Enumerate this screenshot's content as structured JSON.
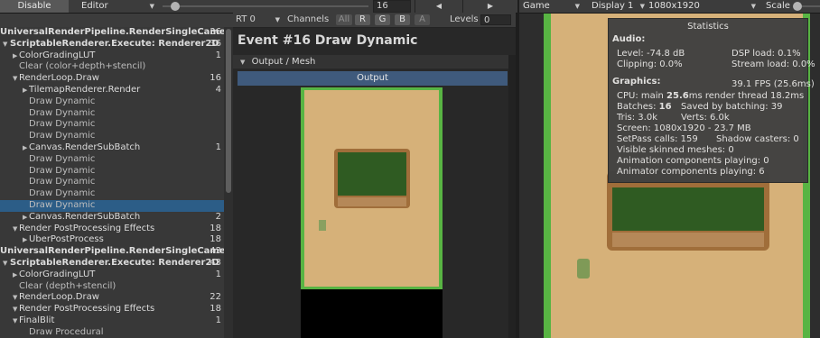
{
  "top_toolbar": {
    "disable_button": "Disable",
    "source_dropdown": "Editor",
    "event_index": "16"
  },
  "debugger_toolbar": {
    "rt_dropdown": "RT 0",
    "channels_label": "Channels",
    "channel_buttons": [
      "All",
      "R",
      "G",
      "B",
      "A"
    ],
    "levels_label": "Levels",
    "levels_value": "0"
  },
  "event_tree": [
    {
      "label": "UniversalRenderPipeline.RenderSingleCameraInt",
      "count": "36",
      "depth": 0,
      "expandable": false
    },
    {
      "label": "ScriptableRenderer.Execute: Renderer2D",
      "count": "36",
      "depth": 0,
      "expandable": true
    },
    {
      "label": "ColorGradingLUT",
      "count": "1",
      "depth": 1,
      "expandable": true
    },
    {
      "label": "Clear (color+depth+stencil)",
      "count": "",
      "depth": 1,
      "expandable": false
    },
    {
      "label": "RenderLoop.Draw",
      "count": "16",
      "depth": 1,
      "expandable": true
    },
    {
      "label": "TilemapRenderer.Render",
      "count": "4",
      "depth": 2,
      "expandable": true
    },
    {
      "label": "Draw Dynamic",
      "count": "",
      "depth": 2,
      "expandable": false
    },
    {
      "label": "Draw Dynamic",
      "count": "",
      "depth": 2,
      "expandable": false
    },
    {
      "label": "Draw Dynamic",
      "count": "",
      "depth": 2,
      "expandable": false
    },
    {
      "label": "Draw Dynamic",
      "count": "",
      "depth": 2,
      "expandable": false
    },
    {
      "label": "Canvas.RenderSubBatch",
      "count": "1",
      "depth": 2,
      "expandable": true
    },
    {
      "label": "Draw Dynamic",
      "count": "",
      "depth": 2,
      "expandable": false
    },
    {
      "label": "Draw Dynamic",
      "count": "",
      "depth": 2,
      "expandable": false
    },
    {
      "label": "Draw Dynamic",
      "count": "",
      "depth": 2,
      "expandable": false
    },
    {
      "label": "Draw Dynamic",
      "count": "",
      "depth": 2,
      "expandable": false
    },
    {
      "label": "Draw Dynamic",
      "count": "",
      "depth": 2,
      "expandable": false,
      "selected": true
    },
    {
      "label": "Canvas.RenderSubBatch",
      "count": "2",
      "depth": 2,
      "expandable": true
    },
    {
      "label": "Render PostProcessing Effects",
      "count": "18",
      "depth": 1,
      "expandable": true
    },
    {
      "label": "UberPostProcess",
      "count": "18",
      "depth": 2,
      "expandable": true
    },
    {
      "label": "UniversalRenderPipeline.RenderSingleCameraInt",
      "count": "43",
      "depth": 0,
      "expandable": false
    },
    {
      "label": "ScriptableRenderer.Execute: Renderer2D",
      "count": "43",
      "depth": 0,
      "expandable": true
    },
    {
      "label": "ColorGradingLUT",
      "count": "1",
      "depth": 1,
      "expandable": true
    },
    {
      "label": "Clear (depth+stencil)",
      "count": "",
      "depth": 1,
      "expandable": false
    },
    {
      "label": "RenderLoop.Draw",
      "count": "22",
      "depth": 1,
      "expandable": true
    },
    {
      "label": "Render PostProcessing Effects",
      "count": "18",
      "depth": 1,
      "expandable": true
    },
    {
      "label": "FinalBlit",
      "count": "1",
      "depth": 1,
      "expandable": true
    },
    {
      "label": "Draw Procedural",
      "count": "",
      "depth": 2,
      "expandable": false
    }
  ],
  "event_detail": {
    "title": "Event #16 Draw Dynamic",
    "section_label": "Output / Mesh",
    "output_tab": "Output"
  },
  "game_toolbar": {
    "game_dropdown": "Game",
    "display_dropdown": "Display 1",
    "resolution_dropdown": "1080x1920",
    "scale_label": "Scale"
  },
  "statistics": {
    "title": "Statistics",
    "audio_header": "Audio:",
    "level": "Level: -74.8 dB",
    "clipping": "Clipping: 0.0%",
    "dsp_load": "DSP load: 0.1%",
    "stream_load": "Stream load: 0.0%",
    "graphics_header": "Graphics:",
    "fps": "39.1 FPS (25.6ms)",
    "cpu_main_prefix": "CPU: main ",
    "cpu_main_value": "25.6",
    "cpu_main_suffix": "ms  render thread 18.2ms",
    "batches_prefix": "Batches: ",
    "batches_value": "16",
    "saved_by_batching": "Saved by batching: 39",
    "tris": "Tris: 3.0k",
    "verts": "Verts: 6.0k",
    "screen": "Screen: 1080x1920 - 23.7 MB",
    "setpass": "SetPass calls: 159",
    "shadow_casters": "Shadow casters: 0",
    "visible_skinned": "Visible skinned meshes: 0",
    "animation_components": "Animation components playing: 0",
    "animator_components": "Animator components playing: 6"
  },
  "colors": {
    "selection": "#2c5d87",
    "grass": "#58b443",
    "sand": "#d6b179",
    "tile": "#2f5b22"
  }
}
